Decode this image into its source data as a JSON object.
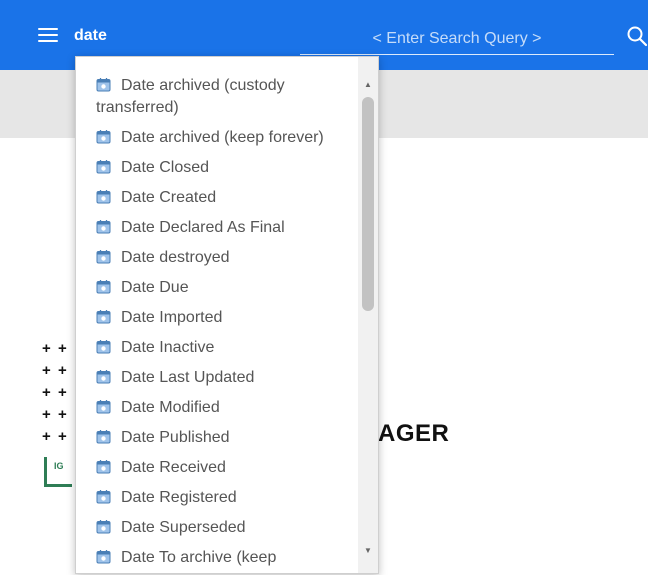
{
  "header": {
    "query_text": "date",
    "search_placeholder": "< Enter Search Query >"
  },
  "brand": {
    "text": "AGER",
    "logo_text": "IG"
  },
  "dropdown": {
    "items": [
      "Date archived (custody transferred)",
      "Date archived (keep forever)",
      "Date Closed",
      "Date Created",
      "Date Declared As Final",
      "Date destroyed",
      "Date Due",
      "Date Imported",
      "Date Inactive",
      "Date Last Updated",
      "Date Modified",
      "Date Published",
      "Date Received",
      "Date Registered",
      "Date Superseded",
      "Date To archive (keep"
    ],
    "scroll_position": 0.0
  },
  "colors": {
    "topbar": "#1a73e8",
    "icon_fill": "#9fc3ea",
    "icon_stroke": "#4a7fb6"
  }
}
